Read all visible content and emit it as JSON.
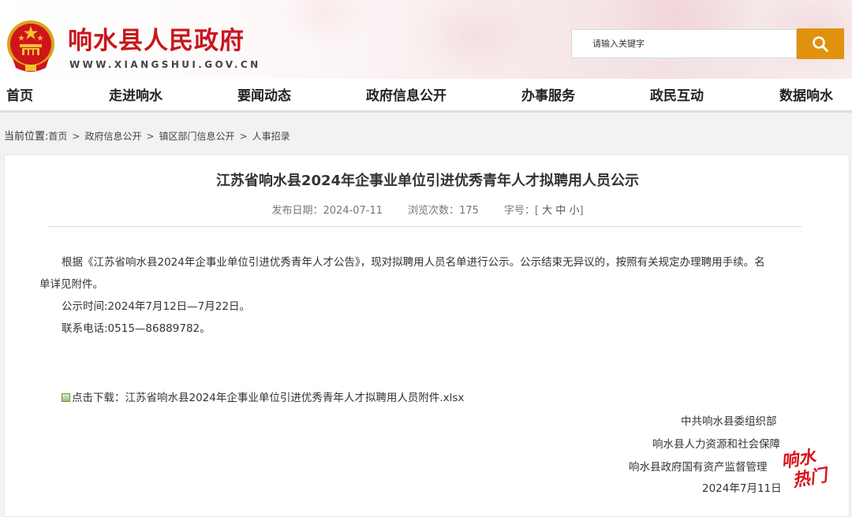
{
  "header": {
    "site_title": "响水县人民政府",
    "site_domain": "WWW.XIANGSHUI.GOV.CN",
    "search_placeholder": "请输入关键字"
  },
  "nav": {
    "items": [
      "首页",
      "走进响水",
      "要闻动态",
      "政府信息公开",
      "办事服务",
      "政民互动",
      "数据响水"
    ]
  },
  "breadcrumb": {
    "lead": "当前位置:",
    "items": [
      "首页",
      "政府信息公开",
      "镇区部门信息公开",
      "人事招录"
    ],
    "separator": ">"
  },
  "article": {
    "title": "江苏省响水县2024年企事业单位引进优秀青年人才拟聘用人员公示",
    "publish_label": "发布日期：",
    "publish_date": "2024-07-11",
    "views_label": "浏览次数：",
    "views": "175",
    "font_label": "字号：",
    "font_open": "[",
    "font_large": "大",
    "font_medium": "中",
    "font_small": "小",
    "font_close": "]",
    "body_line1": "根据《江苏省响水县2024年企事业单位引进优秀青年人才公告》，现对拟聘用人员名单进行公示。公示结束无异议的，按照有关规定办理聘用手续。名",
    "body_line2": "单详见附件。",
    "period": "公示时间:2024年7月12日—7月22日。",
    "phone": "联系电话:0515—86889782。",
    "download_label": "点击下载：",
    "download_file": "江苏省响水县2024年企事业单位引进优秀青年人才拟聘用人员附件.xlsx",
    "signatures": [
      "中共响水县委组织部",
      "响水县人力资源和社会保障",
      "响水县政府国有资产监督管理"
    ],
    "date": "2024年7月11日"
  },
  "watermark": {
    "line1": "响水",
    "line2": "热门",
    "color": "#d8141b"
  },
  "colors": {
    "brand_red": "#c8161d",
    "search_orange": "#e0920f"
  }
}
